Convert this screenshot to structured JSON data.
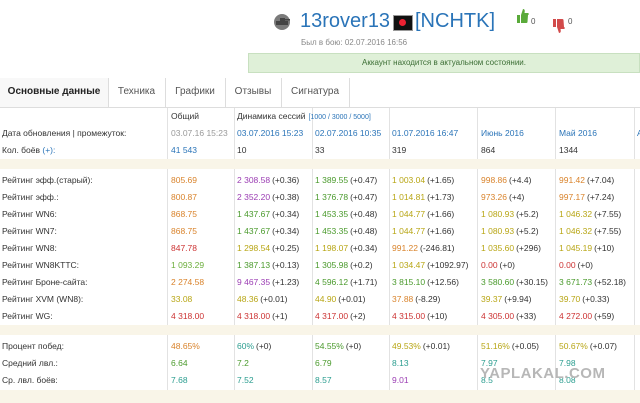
{
  "player": {
    "name": "13rover13",
    "clan": "[NCHTK]",
    "last_battle": "Был в бою: 02.07.2016 16:56",
    "likes": "0",
    "dislikes": "0"
  },
  "notice": "Аккаунт находится в актуальном состоянии.",
  "tabs": [
    "Основные данные",
    "Техника",
    "Графики",
    "Отзывы",
    "Сигнатура"
  ],
  "table": {
    "col_general": "Общий",
    "col_sessions": "Динамика сессий",
    "sessions_sub": "[1000 / 3000 / 5000]",
    "date_row": {
      "label": "Дата обновления | промежуток:",
      "general": "03.07.16 15:23",
      "cols": [
        "03.07.2016 15:23",
        "02.07.2016 10:35",
        "01.07.2016 16:47",
        "Июнь 2016",
        "Май 2016",
        "А"
      ]
    },
    "battles_row": {
      "label": "Кол. боёв",
      "link": "(+):",
      "general": "41 543",
      "cols": [
        "10",
        "33",
        "319",
        "864",
        "1344"
      ]
    },
    "rows": [
      {
        "label": "Рейтинг эфф.(старый):",
        "general": "805.69",
        "gc": "c-orange",
        "cols": [
          [
            "2 308.58",
            "(+0.36)",
            "c-purple"
          ],
          [
            "1 389.55",
            "(+0.47)",
            "c-green"
          ],
          [
            "1 003.04",
            "(+1.65)",
            "c-yellow"
          ],
          [
            "998.86",
            "(+4.4)",
            "c-orange"
          ],
          [
            "991.42",
            "(+7.04)",
            "c-orange"
          ]
        ]
      },
      {
        "label": "Рейтинг эфф.:",
        "general": "800.87",
        "gc": "c-orange",
        "cols": [
          [
            "2 352.20",
            "(+0.38)",
            "c-purple"
          ],
          [
            "1 376.78",
            "(+0.47)",
            "c-green"
          ],
          [
            "1 014.81",
            "(+1.73)",
            "c-yellow"
          ],
          [
            "973.26",
            "(+4)",
            "c-orange"
          ],
          [
            "997.17",
            "(+7.24)",
            "c-orange"
          ]
        ]
      },
      {
        "label": "Рейтинг WN6:",
        "general": "868.75",
        "gc": "c-orange",
        "cols": [
          [
            "1 437.67",
            "(+0.34)",
            "c-green"
          ],
          [
            "1 453.35",
            "(+0.48)",
            "c-green"
          ],
          [
            "1 044.77",
            "(+1.66)",
            "c-yellow"
          ],
          [
            "1 080.93",
            "(+5.2)",
            "c-yellow"
          ],
          [
            "1 046.32",
            "(+7.55)",
            "c-yellow"
          ]
        ]
      },
      {
        "label": "Рейтинг WN7:",
        "general": "868.75",
        "gc": "c-orange",
        "cols": [
          [
            "1 437.67",
            "(+0.34)",
            "c-green"
          ],
          [
            "1 453.35",
            "(+0.48)",
            "c-green"
          ],
          [
            "1 044.77",
            "(+1.66)",
            "c-yellow"
          ],
          [
            "1 080.93",
            "(+5.2)",
            "c-yellow"
          ],
          [
            "1 046.32",
            "(+7.55)",
            "c-yellow"
          ]
        ]
      },
      {
        "label": "Рейтинг WN8:",
        "general": "847.78",
        "gc": "c-red",
        "cols": [
          [
            "1 298.54",
            "(+0.25)",
            "c-yellow"
          ],
          [
            "1 198.07",
            "(+0.34)",
            "c-yellow"
          ],
          [
            "991.22",
            "(-246.81)",
            "c-orange"
          ],
          [
            "1 035.60",
            "(+296)",
            "c-yellow"
          ],
          [
            "1 045.19",
            "(+10)",
            "c-yellow"
          ]
        ]
      },
      {
        "label": "Рейтинг WN8KTTC:",
        "general": "1 093.29",
        "gc": "c-lgreen",
        "cols": [
          [
            "1 387.13",
            "(+0.13)",
            "c-green"
          ],
          [
            "1 305.98",
            "(+0.2)",
            "c-green"
          ],
          [
            "1 034.47",
            "(+1092.97)",
            "c-yellow"
          ],
          [
            "0.00",
            "(+0)",
            "c-red"
          ],
          [
            "0.00",
            "(+0)",
            "c-red"
          ]
        ]
      },
      {
        "label": "Рейтинг Броне-сайта:",
        "general": "2 274.58",
        "gc": "c-orange",
        "cols": [
          [
            "9 467.35",
            "(+1.23)",
            "c-purple"
          ],
          [
            "4 596.12",
            "(+1.71)",
            "c-green"
          ],
          [
            "3 815.10",
            "(+12.56)",
            "c-green"
          ],
          [
            "3 580.60",
            "(+30.15)",
            "c-green"
          ],
          [
            "3 671.73",
            "(+52.18)",
            "c-green"
          ]
        ]
      },
      {
        "label": "Рейтинг XVM (WN8):",
        "general": "33.08",
        "gc": "c-yellow",
        "cols": [
          [
            "48.36",
            "(+0.01)",
            "c-yellow"
          ],
          [
            "44.90",
            "(+0.01)",
            "c-yellow"
          ],
          [
            "37.88",
            "(-8.29)",
            "c-orange"
          ],
          [
            "39.37",
            "(+9.94)",
            "c-yellow"
          ],
          [
            "39.70",
            "(+0.33)",
            "c-yellow"
          ]
        ]
      },
      {
        "label": "Рейтинг WG:",
        "general": "4 318.00",
        "gc": "c-red",
        "cols": [
          [
            "4 318.00",
            "(+1)",
            "c-red"
          ],
          [
            "4 317.00",
            "(+2)",
            "c-red"
          ],
          [
            "4 315.00",
            "(+10)",
            "c-red"
          ],
          [
            "4 305.00",
            "(+33)",
            "c-red"
          ],
          [
            "4 272.00",
            "(+59)",
            "c-red"
          ]
        ]
      }
    ],
    "rows2": [
      {
        "label": "Процент побед:",
        "general": "48.65%",
        "gc": "c-orange",
        "cols": [
          [
            "60%",
            "(+0)",
            "c-teal"
          ],
          [
            "54.55%",
            "(+0)",
            "c-green"
          ],
          [
            "49.53%",
            "(+0.01)",
            "c-yellow"
          ],
          [
            "51.16%",
            "(+0.05)",
            "c-yellow"
          ],
          [
            "50.67%",
            "(+0.07)",
            "c-yellow"
          ]
        ]
      },
      {
        "label": "Средний лвл.:",
        "general": "6.64",
        "gc": "c-green",
        "cols": [
          [
            "7.2",
            "",
            "c-green"
          ],
          [
            "6.79",
            "",
            "c-green"
          ],
          [
            "8.13",
            "",
            "c-teal"
          ],
          [
            "7.97",
            "",
            "c-teal"
          ],
          [
            "7.98",
            "",
            "c-teal"
          ]
        ]
      },
      {
        "label": "Ср. лвл. боёв:",
        "general": "7.68",
        "gc": "c-teal",
        "cols": [
          [
            "7.52",
            "",
            "c-teal"
          ],
          [
            "8.57",
            "",
            "c-teal"
          ],
          [
            "9.01",
            "",
            "c-purple"
          ],
          [
            "8.5",
            "",
            "c-teal"
          ],
          [
            "8.08",
            "",
            "c-teal"
          ]
        ]
      }
    ]
  },
  "watermark": "YAPLAKAL.COM",
  "colors": {
    "link": "#2a74b8",
    "notice_bg": "#dff0d8",
    "band": "#f9f5e8"
  },
  "icons": [
    "tank-icon",
    "pirate-flag-icon",
    "thumb-up-icon",
    "thumb-down-icon"
  ]
}
